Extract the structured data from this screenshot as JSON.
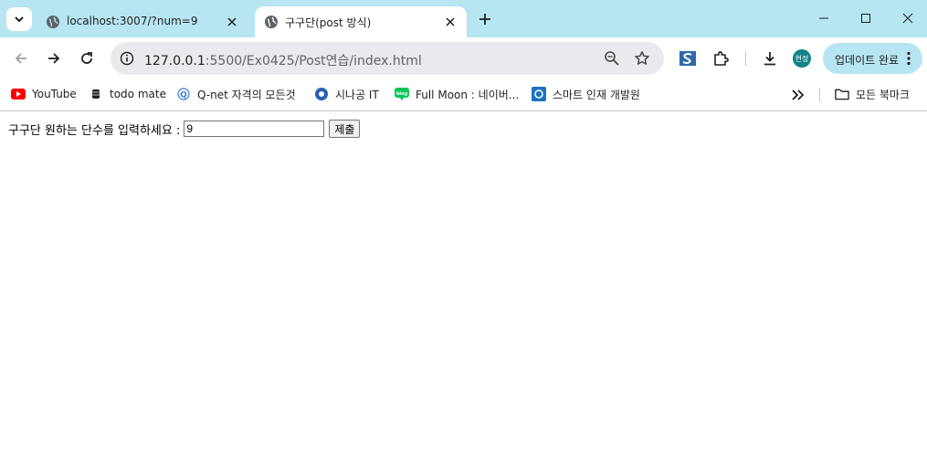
{
  "tabs": [
    {
      "title": "localhost:3007/?num=9",
      "active": false
    },
    {
      "title": "구구단(post 방식)",
      "active": true
    }
  ],
  "toolbar": {
    "url_host": "127.0.0.1",
    "url_path": ":5500/Ex0425/Post연습/index.html",
    "profile_label": "현정",
    "update_label": "업데이트 완료"
  },
  "bookmarks": [
    {
      "label": "YouTube",
      "icon": "youtube-icon"
    },
    {
      "label": "todo mate",
      "icon": "todo-mate-icon"
    },
    {
      "label": "Q-net 자격의 모든것",
      "icon": "qnet-icon"
    },
    {
      "label": "시나공 IT",
      "icon": "sinagong-icon"
    },
    {
      "label": "Full Moon : 네이버...",
      "icon": "blog-icon"
    },
    {
      "label": "스마트 인재 개발원",
      "icon": "smart-icon"
    }
  ],
  "all_bookmarks_label": "모든 북마크",
  "form": {
    "label": "구구단 원하는 단수를 입력하세요 :",
    "input_value": "9",
    "submit_label": "제출"
  },
  "colors": {
    "tabstrip": "#b7e6f2",
    "omnibox": "#e8eaed",
    "profile": "#12828a"
  }
}
